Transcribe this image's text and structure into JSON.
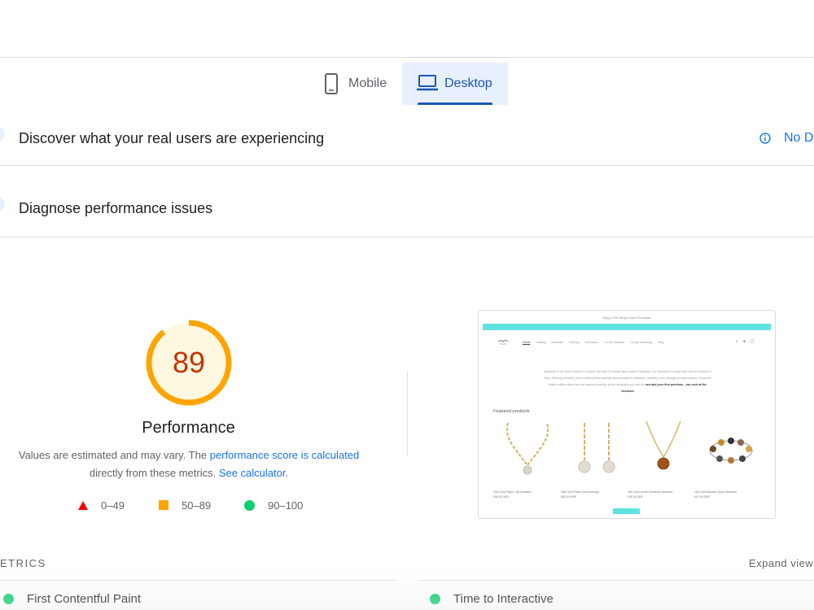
{
  "device_tabs": {
    "mobile": {
      "label": "Mobile",
      "icon": "smartphone-icon",
      "selected": false
    },
    "desktop": {
      "label": "Desktop",
      "icon": "laptop-icon",
      "selected": true
    }
  },
  "sections": {
    "real_users": {
      "title": "Discover what your real users are experiencing",
      "no_data_label": "No D"
    },
    "diagnose": {
      "title": "Diagnose performance issues"
    }
  },
  "score": {
    "value": "89",
    "fraction": 0.89,
    "category": "Performance",
    "color": "#ffa400",
    "desc_prefix": "Values are estimated and may vary. The ",
    "desc_link1": "performance score is calculated",
    "desc_middle": " directly from these metrics. ",
    "desc_link2": "See calculator",
    "desc_suffix": "."
  },
  "legend": {
    "fail": "0–49",
    "average": "50–89",
    "pass": "90–100"
  },
  "colors": {
    "fail": "#ff0000",
    "average": "#ffa400",
    "pass": "#0cce6b",
    "accent": "#1a73e8"
  },
  "preview": {
    "offer_text": "Enjoy 10% off your first Purchase",
    "nav": [
      "Home",
      "Catalog",
      "Bracelets",
      "Earrings",
      "Necklaces",
      "Luxury Watches",
      "Luxury Handbags",
      "Blog"
    ],
    "welcome_text": "Welcome to the finest Jewelry in London. We offer European hand-crafted Jewellery. Our Jewellery is unique with only the modern in mind. Winning Jewellery that is making finest earrings and necklace & unfamiliar. Jewellery from heritage and generations. Exclusive limited edition offers the true inspired jewellery by the designers you love the",
    "welcome_bold": "and add your first purchase - use code at the checkout",
    "featured_title": "Featured products",
    "products": [
      {
        "name": "18ct Gold Paper Clip Bracelet",
        "price": "£95.00 GBP"
      },
      {
        "name": "18ct Gold Pearl Drop Earrings",
        "price": "£85.00 GBP"
      },
      {
        "name": "18ct Gold Amber Pendant Necklace",
        "price": "£95.00 GBP"
      },
      {
        "name": "18ct Gold Beaded Stone Bracelet",
        "price": "£97.00 GBP"
      }
    ]
  },
  "metrics": {
    "section_label": "ETRICS",
    "expand_label": "Expand view",
    "left": {
      "name": "First Contentful Paint",
      "rating": "pass"
    },
    "right": {
      "name": "Time to Interactive",
      "rating": "pass"
    }
  }
}
